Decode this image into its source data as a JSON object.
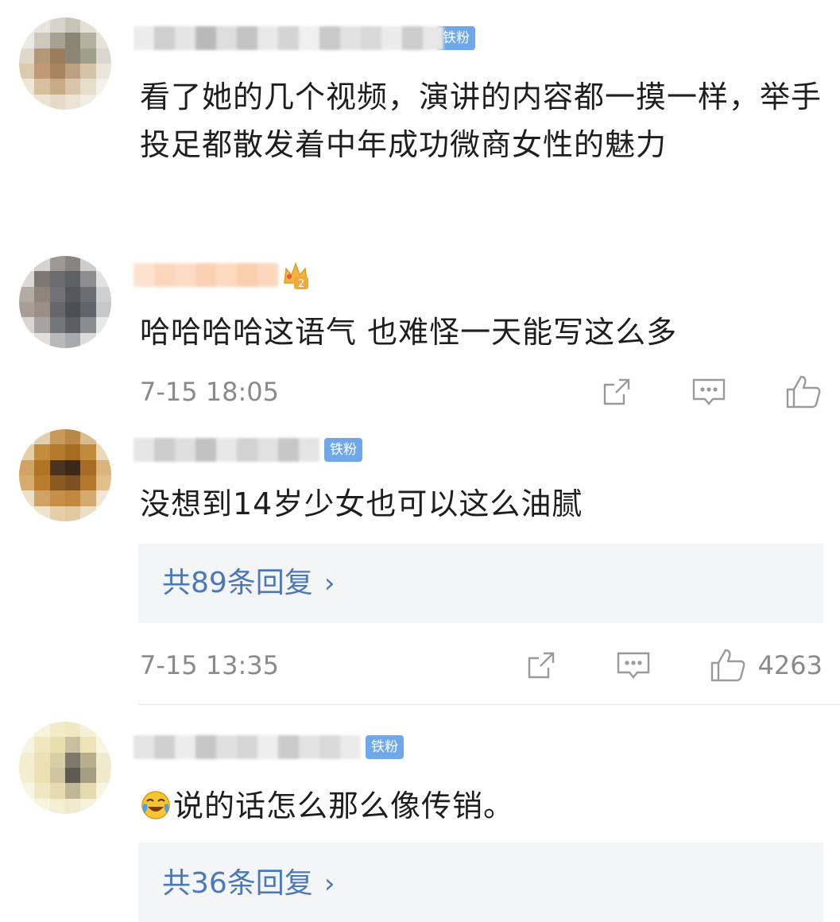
{
  "comments": [
    {
      "badge": "铁粉",
      "text": "看了她的几个视频，演讲的内容都一摸一样，举手投足都散发着中年成功微商女性的魅力"
    },
    {
      "text": "哈哈哈哈这语气 也难怪一天能写这么多",
      "time": "7-15 18:05",
      "level": "2"
    },
    {
      "badge": "铁粉",
      "text": "没想到14岁少女也可以这么油腻",
      "reply_label": "共89条回复",
      "time": "7-15 13:35",
      "likes": "4263"
    },
    {
      "badge": "铁粉",
      "text": "说的话怎么那么像传销。",
      "emoji": "laughing-crying-icon",
      "reply_label": "共36条回复"
    }
  ],
  "icons": {
    "share": "share-icon",
    "comment": "comment-icon",
    "like": "thumbs-up-icon",
    "chevron": "chevron-right-icon"
  },
  "colors": {
    "badge": "#6fa8ea",
    "reply_link": "#4a78b8",
    "meta": "#8a8a8a"
  }
}
